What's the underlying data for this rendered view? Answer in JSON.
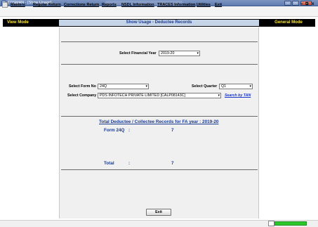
{
  "window": {
    "title": "TDSMAN - [Show Usage]",
    "min_glyph": "–",
    "max_glyph": "□",
    "close_glyph": "✕"
  },
  "menu": {
    "items": [
      "Masters",
      "Regular Return",
      "Corrections Return",
      "Reports",
      "NSDL Information",
      "TRACES Information",
      "Utilities",
      "Exit"
    ],
    "mdi_minimize": "–",
    "mdi_restore": "⧉",
    "mdi_close": "x"
  },
  "header": {
    "left_mode": "View Mode",
    "title": "Show Usage - Deductee Records",
    "right_mode": "General Mode"
  },
  "form": {
    "financial_year_label": "Select Financial Year",
    "financial_year_value": "2019-20",
    "form_no_label": "Select Form No",
    "form_no_value": "24Q",
    "quarter_label": "Select Quarter",
    "quarter_value": "Q1",
    "company_label": "Select Company",
    "company_value": "PDS INFOTECH PRIVATE LIMITED [CALP08143C]",
    "search_link": "Search by TAN"
  },
  "records": {
    "title": "Total Deductee / Collectee Records for FA year : 2019-20",
    "rows": [
      {
        "label": "Form 24Q",
        "sep": ":",
        "value": "7"
      }
    ],
    "total": {
      "label": "Total",
      "sep": ":",
      "value": "7"
    }
  },
  "buttons": {
    "exit": "Exit"
  },
  "icons": {
    "dropdown": "▾"
  }
}
